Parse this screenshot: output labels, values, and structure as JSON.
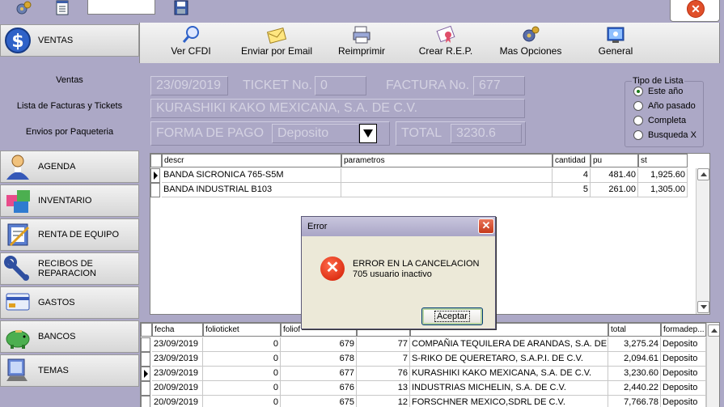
{
  "toolbar": {
    "buttons": [
      {
        "label": "Ver CFDI",
        "icon": "magnifier-icon"
      },
      {
        "label": "Enviar por Email",
        "icon": "envelope-icon"
      },
      {
        "label": "Reimprimir",
        "icon": "printer-icon"
      },
      {
        "label": "Crear R.E.P.",
        "icon": "certificate-icon"
      },
      {
        "label": "Mas Opciones",
        "icon": "gears-icon"
      },
      {
        "label": "General",
        "icon": "display-settings-icon"
      }
    ]
  },
  "sidebar": {
    "items": [
      {
        "label": "VENTAS",
        "icon": "dollar-icon"
      },
      {
        "label": "AGENDA",
        "icon": "person-icon"
      },
      {
        "label": "INVENTARIO",
        "icon": "boxes-icon"
      },
      {
        "label": "RENTA DE EQUIPO",
        "icon": "notebook-icon"
      },
      {
        "label": "RECIBOS DE REPARACION",
        "icon": "wrench-icon"
      },
      {
        "label": "GASTOS",
        "icon": "card-icon"
      },
      {
        "label": "BANCOS",
        "icon": "piggy-bank-icon"
      },
      {
        "label": "TEMAS",
        "icon": "monitor-icon"
      }
    ],
    "sub_items": [
      "Ventas",
      "Lista de Facturas y Tickets",
      "Envios por Paqueteria"
    ]
  },
  "form": {
    "date": "23/09/2019",
    "ticket_label": "TICKET No.",
    "ticket_value": "0",
    "factura_label": "FACTURA No.",
    "factura_value": "677",
    "client": "KURASHIKI KAKO MEXICANA, S.A. DE C.V.",
    "forma_label": "FORMA DE PAGO",
    "forma_value": "Deposito",
    "total_label": "TOTAL",
    "total_value": "3230.6"
  },
  "tipo_lista": {
    "title": "Tipo de Lista",
    "options": [
      "Este año",
      "Año pasado",
      "Completa",
      "Busqueda X"
    ],
    "selected": 0
  },
  "detail_grid": {
    "headers": [
      "descr",
      "parametros",
      "cantidad",
      "pu",
      "st"
    ],
    "rows": [
      {
        "descr": "BANDA SICRONICA 765-S5M",
        "parametros": "",
        "cantidad": "4",
        "pu": "481.40",
        "st": "1,925.60"
      },
      {
        "descr": "BANDA INDUSTRIAL B103",
        "parametros": "",
        "cantidad": "5",
        "pu": "261.00",
        "st": "1,305.00"
      }
    ]
  },
  "list_grid": {
    "headers": [
      "fecha",
      "folioticket",
      "foliof",
      "",
      "",
      "total",
      "formadep..."
    ],
    "rows": [
      {
        "fecha": "23/09/2019",
        "folioticket": "0",
        "foliof": "679",
        "num": "77",
        "cliente": "COMPAÑIA TEQUILERA DE ARANDAS, S.A. DE",
        "total": "3,275.24",
        "forma": "Deposito"
      },
      {
        "fecha": "23/09/2019",
        "folioticket": "0",
        "foliof": "678",
        "num": "7",
        "cliente": "S-RIKO DE QUERETARO, S.A.P.I. DE C.V.",
        "total": "2,094.61",
        "forma": "Deposito"
      },
      {
        "fecha": "23/09/2019",
        "folioticket": "0",
        "foliof": "677",
        "num": "76",
        "cliente": "KURASHIKI KAKO MEXICANA, S.A. DE C.V.",
        "total": "3,230.60",
        "forma": "Deposito"
      },
      {
        "fecha": "20/09/2019",
        "folioticket": "0",
        "foliof": "676",
        "num": "13",
        "cliente": "INDUSTRIAS MICHELIN, S.A. DE C.V.",
        "total": "2,440.22",
        "forma": "Deposito"
      },
      {
        "fecha": "20/09/2019",
        "folioticket": "0",
        "foliof": "675",
        "num": "12",
        "cliente": "FORSCHNER MEXICO,SDRL DE C.V.",
        "total": "7,766.78",
        "forma": "Deposito"
      }
    ]
  },
  "dialog": {
    "title": "Error",
    "message_line1": "ERROR EN LA CANCELACION",
    "message_line2": "705 usuario inactivo",
    "ok_label": "Aceptar"
  }
}
